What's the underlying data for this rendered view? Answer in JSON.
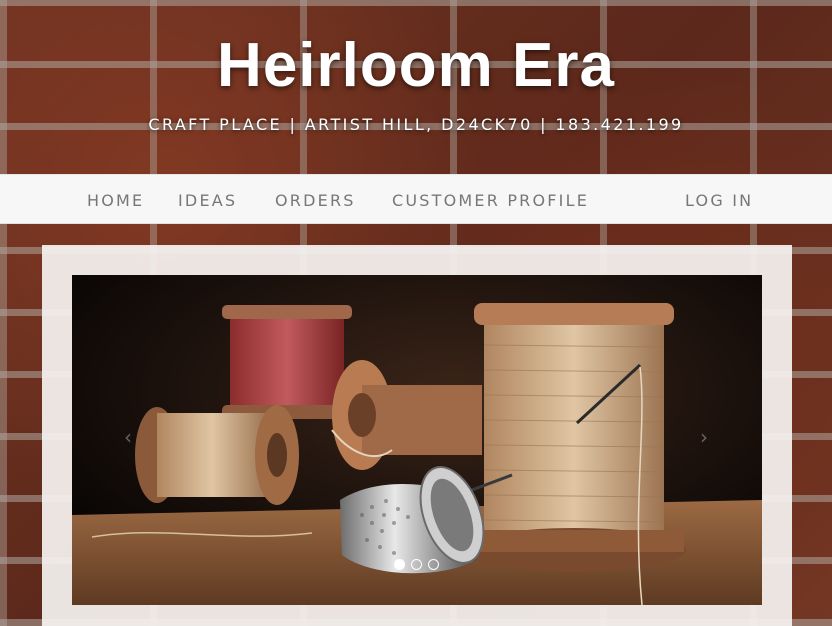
{
  "header": {
    "title": "Heirloom Era",
    "subtitle": "CRAFT PLACE | ARTIST HILL, D24CK70 | 183.421.199"
  },
  "nav": {
    "items": [
      {
        "label": "HOME"
      },
      {
        "label": "IDEAS"
      },
      {
        "label": "ORDERS"
      },
      {
        "label": "CUSTOMER PROFILE"
      }
    ],
    "login": "LOG IN"
  },
  "carousel": {
    "prev_icon": "‹",
    "next_icon": "›",
    "slide_count": 3,
    "active_slide": 1,
    "image_icon": "thread-spools-and-thimble-photo"
  },
  "colors": {
    "nav_text": "#777777",
    "nav_bg": "#f7f7f7",
    "title": "#ffffff"
  }
}
